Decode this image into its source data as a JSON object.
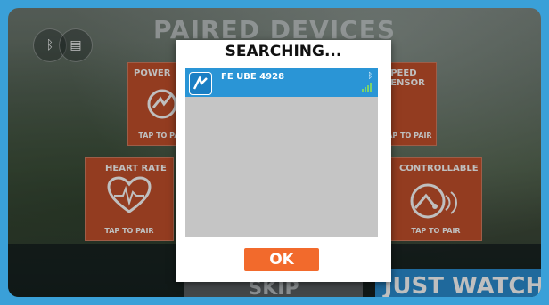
{
  "screen": {
    "title": "PAIRED DEVICES",
    "buttons": {
      "bluetooth_icon": "bluetooth-icon",
      "device_icon": "device-icon"
    }
  },
  "tiles": [
    {
      "label": "POWER",
      "tap": "TAP TO PAIR"
    },
    {
      "label": "SPEED SENSOR",
      "tap": "TAP TO PAIR"
    },
    {
      "label": "HEART RATE",
      "tap": "TAP TO PAIR"
    },
    {
      "label": "CONTROLLABLE",
      "tap": "TAP TO PAIR"
    }
  ],
  "footer": {
    "skip": "SKIP",
    "just_watch": "JUST WATCH"
  },
  "dialog": {
    "title": "SEARCHING...",
    "devices": [
      {
        "name": "FE UBE 4928"
      }
    ],
    "ok": "OK"
  },
  "colors": {
    "tile": "#c4512b",
    "accent": "#2a95d6",
    "ok": "#f26a2c"
  }
}
